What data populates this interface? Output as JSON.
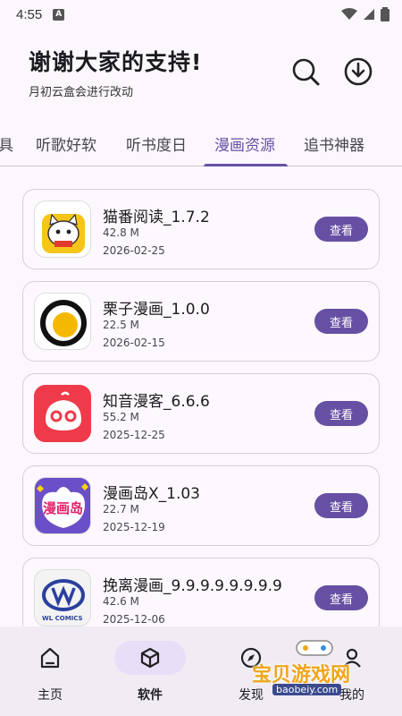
{
  "status_bar": {
    "time": "4:55",
    "a_badge": "A"
  },
  "header": {
    "title": "谢谢大家的支持!",
    "subtitle": "月初云盒会进行改动"
  },
  "tabs": [
    {
      "label": "具"
    },
    {
      "label": "听歌好软"
    },
    {
      "label": "听书度日"
    },
    {
      "label": "漫画资源",
      "active": true
    },
    {
      "label": "追书神器"
    }
  ],
  "apps": [
    {
      "name": "猫番阅读_1.7.2",
      "size": "42.8 M",
      "date": "2026-02-25",
      "button": "查看"
    },
    {
      "name": "栗子漫画_1.0.0",
      "size": "22.5 M",
      "date": "2026-02-15",
      "button": "查看"
    },
    {
      "name": "知音漫客_6.6.6",
      "size": "55.2 M",
      "date": "2025-12-25",
      "button": "查看"
    },
    {
      "name": "漫画岛X_1.03",
      "size": "22.7 M",
      "date": "2025-12-19",
      "button": "查看",
      "icon_text": "漫画岛"
    },
    {
      "name": "挽离漫画_9.9.9.9.9.9.9.9",
      "size": "42.6 M",
      "date": "2025-12-06",
      "button": "查看",
      "icon_text": "WL COMICS"
    }
  ],
  "nav": [
    {
      "label": "主页"
    },
    {
      "label": "软件",
      "active": true
    },
    {
      "label": "发现"
    },
    {
      "label": "我的"
    }
  ],
  "watermark": {
    "text": "宝贝游戏网",
    "url": "baobeiy.com"
  },
  "colors": {
    "accent": "#6750a4",
    "background": "#fcf7fc",
    "nav_background": "#f1ecf4"
  }
}
